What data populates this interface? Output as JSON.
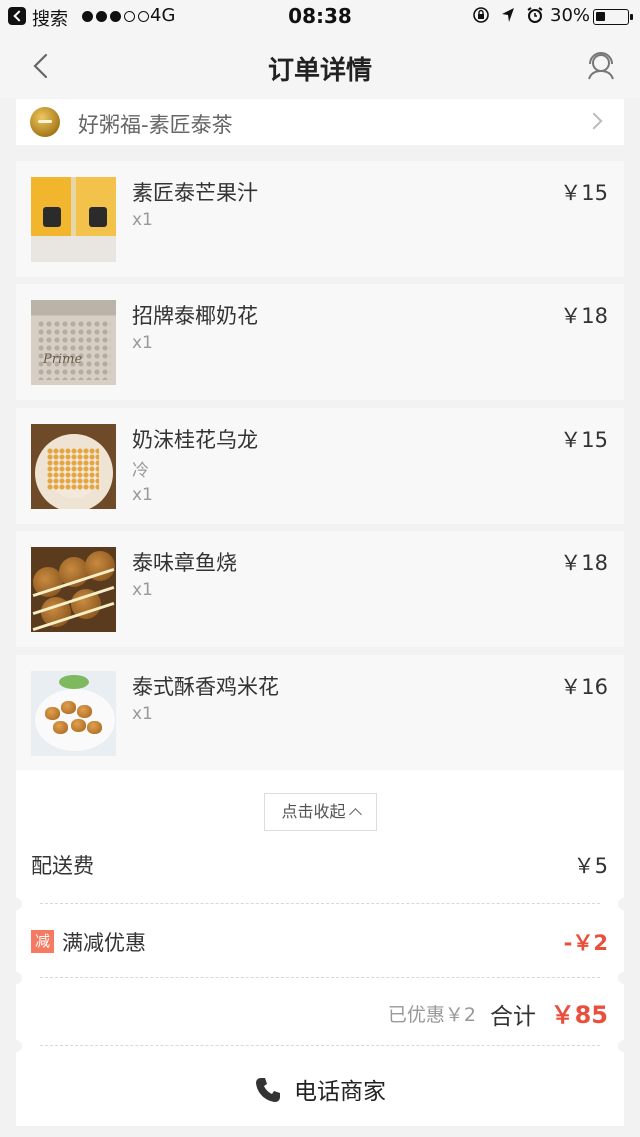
{
  "status_bar": {
    "back_app": "搜索",
    "signal_filled": 3,
    "signal_total": 5,
    "network": "4G",
    "time": "08:38",
    "icons": [
      "orientation-lock-icon",
      "location-arrow-icon",
      "alarm-icon"
    ],
    "battery_percent": "30%",
    "battery_level": 0.3
  },
  "nav": {
    "title": "订单详情",
    "back_icon": "chevron-left-icon",
    "service_icon": "customer-service-icon"
  },
  "store": {
    "name": "好粥福-素匠泰茶"
  },
  "items": [
    {
      "name": "素匠泰芒果汁",
      "price": "￥15",
      "spec": "",
      "qty": "x1",
      "image": "mango-juice-photo"
    },
    {
      "name": "招牌泰椰奶花",
      "price": "￥18",
      "spec": "",
      "qty": "x1",
      "image": "coconut-milk-bottle-photo"
    },
    {
      "name": "奶沫桂花乌龙",
      "price": "￥15",
      "spec": "冷",
      "qty": "x1",
      "image": "osmanthus-oolong-photo"
    },
    {
      "name": "泰味章鱼烧",
      "price": "￥18",
      "spec": "",
      "qty": "x1",
      "image": "takoyaki-photo"
    },
    {
      "name": "泰式酥香鸡米花",
      "price": "￥16",
      "spec": "",
      "qty": "x1",
      "image": "popcorn-chicken-photo"
    }
  ],
  "collapse_label": "点击收起",
  "delivery_fee": {
    "label": "配送费",
    "value": "￥5"
  },
  "discount": {
    "badge": "减",
    "label": "满减优惠",
    "value": "-￥2",
    "color": "#e94f3d"
  },
  "total": {
    "saved": "已优惠￥2",
    "label": "合计",
    "value": "￥85"
  },
  "call": {
    "label": "电话商家"
  }
}
